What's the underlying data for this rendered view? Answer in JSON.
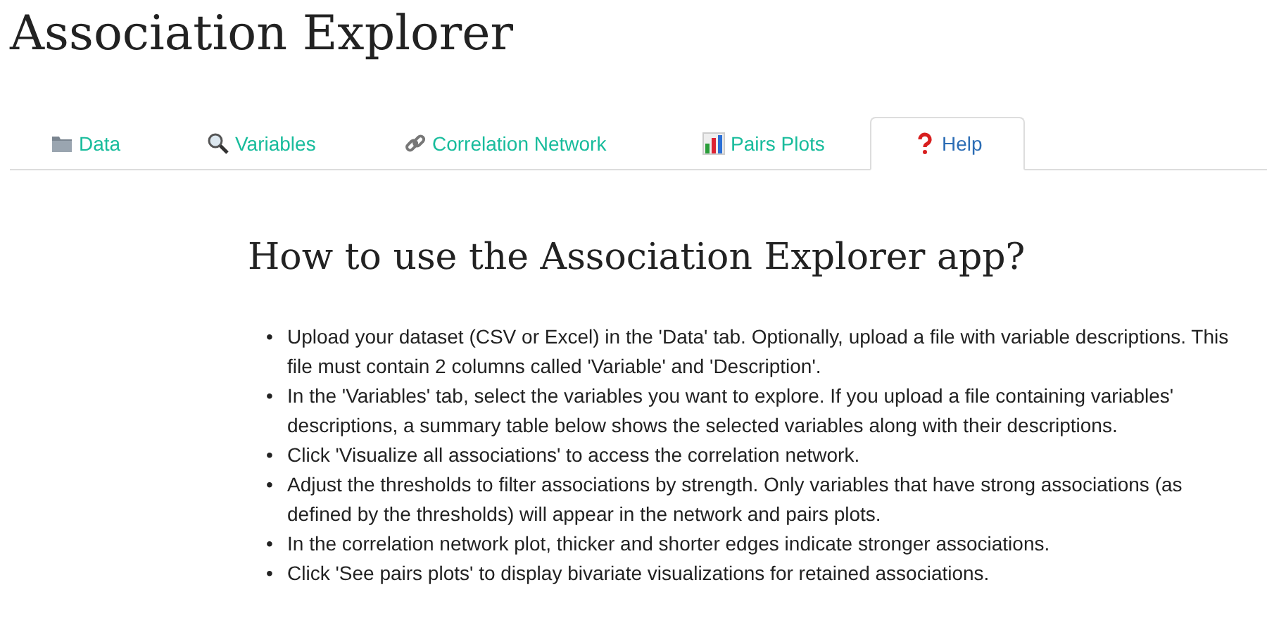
{
  "app_title": "Association Explorer",
  "tabs": [
    {
      "label": "Data",
      "selected": false
    },
    {
      "label": "Variables",
      "selected": false
    },
    {
      "label": "Correlation Network",
      "selected": false
    },
    {
      "label": "Pairs Plots",
      "selected": false
    },
    {
      "label": "Help",
      "selected": true
    }
  ],
  "help": {
    "heading": "How to use the Association Explorer app?",
    "steps": [
      {
        "bullet": "•",
        "text": "Upload your dataset (CSV or Excel) in the 'Data' tab. Optionally, upload a file with variable descriptions. This file must contain 2 columns called 'Variable' and 'Description'."
      },
      {
        "bullet": "•",
        "text": "In the 'Variables' tab, select the variables you want to explore. If you upload a file containing variables' descriptions, a summary table below shows the selected variables along with their descriptions."
      },
      {
        "bullet": "•",
        "text": "Click 'Visualize all associations' to access the correlation network."
      },
      {
        "bullet": "•",
        "text": "Adjust the thresholds to filter associations by strength. Only variables that have strong associations (as defined by the thresholds) will appear in the network and pairs plots."
      },
      {
        "bullet": "•",
        "text": "In the correlation network plot, thicker and shorter edges indicate stronger associations."
      },
      {
        "bullet": "•",
        "text": "Click 'See pairs plots' to display bivariate visualizations for retained associations."
      }
    ]
  }
}
